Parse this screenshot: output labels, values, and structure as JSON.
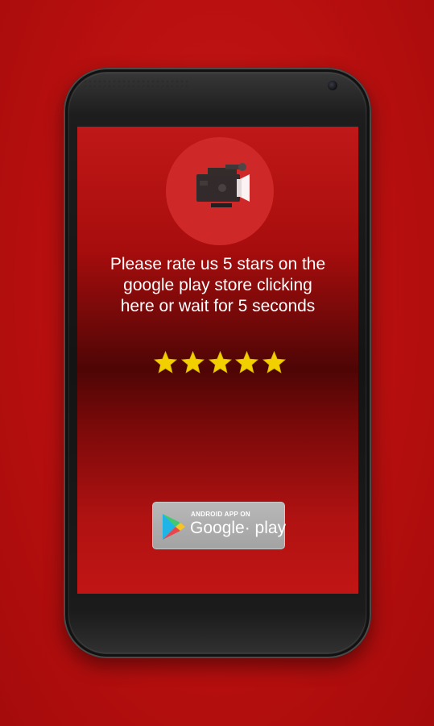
{
  "prompt": {
    "lines": [
      "Please rate us 5 stars on the",
      "google play store clicking",
      "here or wait for 5 seconds"
    ]
  },
  "rating": {
    "max_stars": 5,
    "filled_stars": 5,
    "star_color": "#f2d000"
  },
  "badge": {
    "small_text": "ANDROID APP ON",
    "big_text": "Google· play",
    "icon": "play-store-icon"
  },
  "logo": {
    "icon": "video-camera-icon",
    "circle_color": "#d12a2a"
  },
  "colors": {
    "background": "#b80f0f",
    "screen_top": "#c01818",
    "screen_mid": "#4e0505",
    "phone_body": "#141414",
    "text": "#ffffff"
  }
}
